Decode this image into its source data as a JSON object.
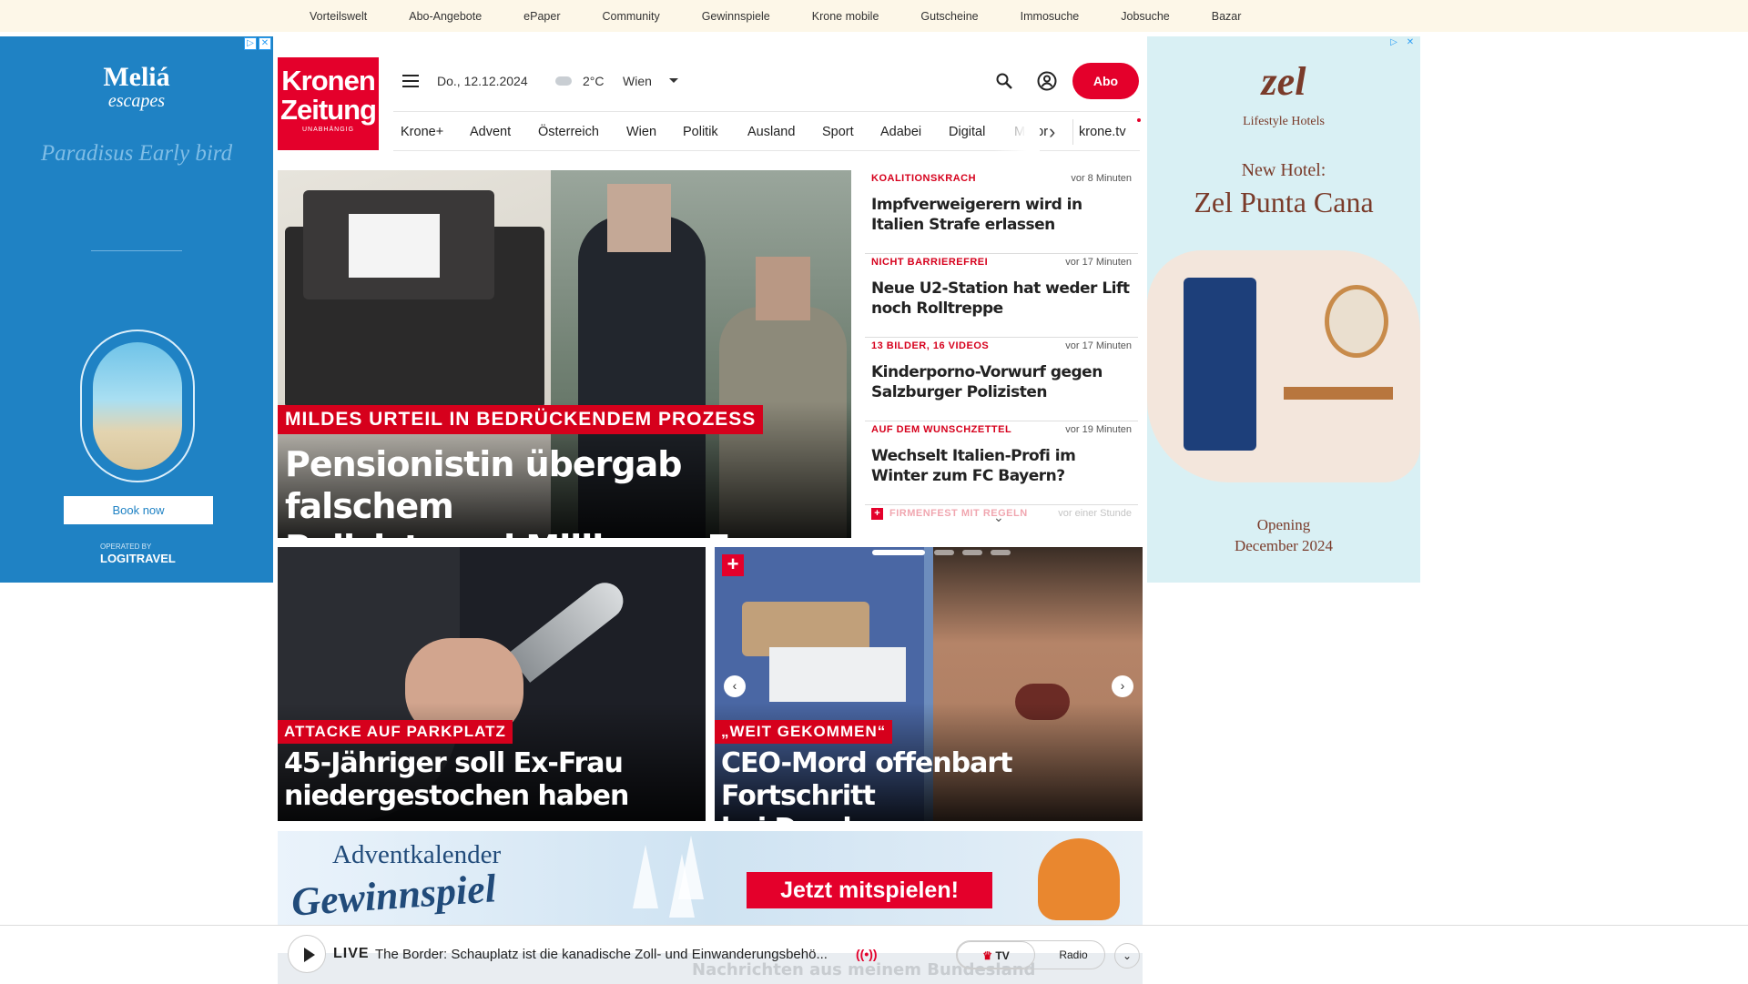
{
  "utility_nav": [
    "Vorteilswelt",
    "Abo-Angebote",
    "ePaper",
    "Community",
    "Gewinnspiele",
    "Krone mobile",
    "Gutscheine",
    "Immosuche",
    "Jobsuche",
    "Bazar"
  ],
  "left_ad": {
    "brand": "Meliá",
    "brand_sub": "escapes",
    "promo": "Paradisus Early bird",
    "cta": "Book now",
    "operated_by": "OPERATED BY",
    "operator": "LOGITRAVEL"
  },
  "right_ad": {
    "logo": "zel",
    "subtitle": "Lifestyle Hotels",
    "new_hotel": "New Hotel:",
    "name": "Zel Punta Cana",
    "opening_1": "Opening",
    "opening_2": "December 2024"
  },
  "logo": {
    "line1": "Kronen",
    "line2": "Zeitung",
    "line3": "UNABHÄNGIG"
  },
  "header": {
    "date": "Do., 12.12.2024",
    "temperature": "2°C",
    "city": "Wien",
    "abo_label": "Abo"
  },
  "nav": {
    "items": [
      "Krone+",
      "Advent",
      "Österreich",
      "Wien",
      "Politik",
      "Ausland",
      "Sport",
      "Adabei",
      "Digital",
      "Motor"
    ],
    "extra": "krone.tv"
  },
  "hero": {
    "kicker": "MILDES URTEIL IN BEDRÜCKENDEM PROZESS",
    "headline_1": "Pensionistin übergab falschem",
    "headline_2": "Polizist zwei Millionen Euro"
  },
  "news": [
    {
      "kicker": "KOALITIONSKRACH",
      "time": "vor 8 Minuten",
      "title": "Impfverweigerern wird in Italien Strafe erlassen"
    },
    {
      "kicker": "NICHT BARRIEREFREI",
      "time": "vor 17 Minuten",
      "title": "Neue U2-Station hat weder Lift noch Rolltreppe"
    },
    {
      "kicker": "13 BILDER, 16 VIDEOS",
      "time": "vor 17 Minuten",
      "title": "Kinderporno-Vorwurf gegen Salzburger Polizisten"
    },
    {
      "kicker": "AUF DEM WUNSCHZETTEL",
      "time": "vor 19 Minuten",
      "title": "Wechselt Italien-Profi im Winter zum FC Bayern?"
    },
    {
      "kicker": "FIRMENFEST MIT REGELN",
      "time": "vor einer Stunde",
      "title": ""
    }
  ],
  "cards": [
    {
      "kicker": "ATTACKE AUF PARKPLATZ",
      "headline_1": "45-Jähriger soll Ex-Frau",
      "headline_2": "niedergestochen haben"
    },
    {
      "kicker": "„WEIT GEKOMMEN“",
      "headline_1": "CEO-Mord offenbart Fortschritt",
      "headline_2": "bei Druck von „Geisterwaffen“"
    }
  ],
  "banner": {
    "line1": "Adventkalender",
    "line2": "Gewinnspiel",
    "cta": "Jetzt mitspielen!"
  },
  "player": {
    "live": "LIVE",
    "title": "The Border: Schauplatz ist die kanadische Zoll- und Einwanderungsbehö...",
    "tv": "TV",
    "radio": "Radio",
    "underlay": "Nachrichten aus meinem Bundesland"
  },
  "colors": {
    "brand_red": "#e4002b",
    "kicker_red": "#d6001c",
    "ad_blue": "#1f82c4"
  }
}
